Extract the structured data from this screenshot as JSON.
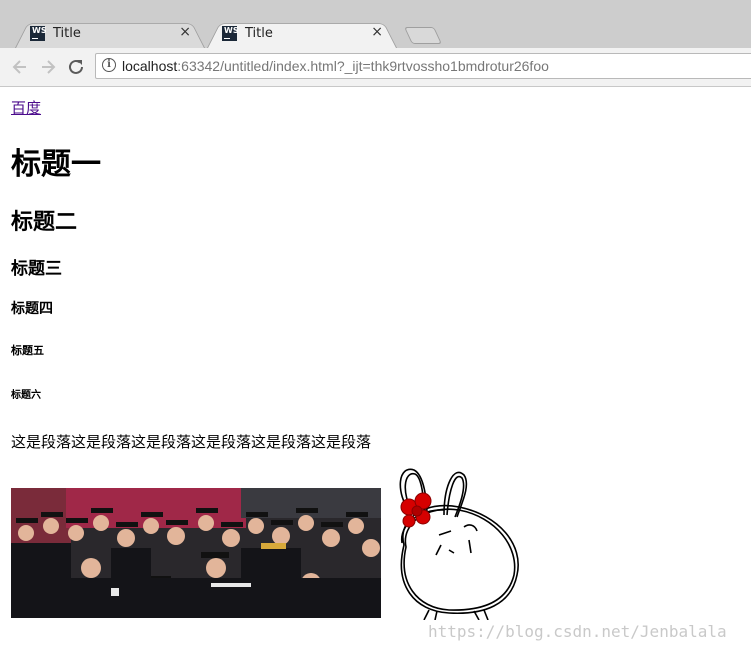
{
  "tabs": [
    {
      "icon": "webstorm-icon",
      "label": "Title",
      "active": false
    },
    {
      "icon": "webstorm-icon",
      "label": "Title",
      "active": true
    }
  ],
  "tab_icon_text": "WS",
  "tab_close_glyph": "×",
  "address_bar": {
    "host": "localhost",
    "rest": ":63342/untitled/index.html?_ijt=thk9rtvossho1bmdrotur26foo"
  },
  "content": {
    "link": "百度",
    "h1": "标题一",
    "h2": "标题二",
    "h3": "标题三",
    "h4": "标题四",
    "h5": "标题五",
    "h6": "标题六",
    "paragraph": "这是段落这是段落这是段落这是段落这是段落这是段落"
  },
  "watermark": "https://blog.csdn.net/Jenbalala",
  "colors": {
    "link_visited": "#4b0b8c",
    "tab_strip": "#cdcdcd",
    "bunny_bow": "#d60000"
  }
}
